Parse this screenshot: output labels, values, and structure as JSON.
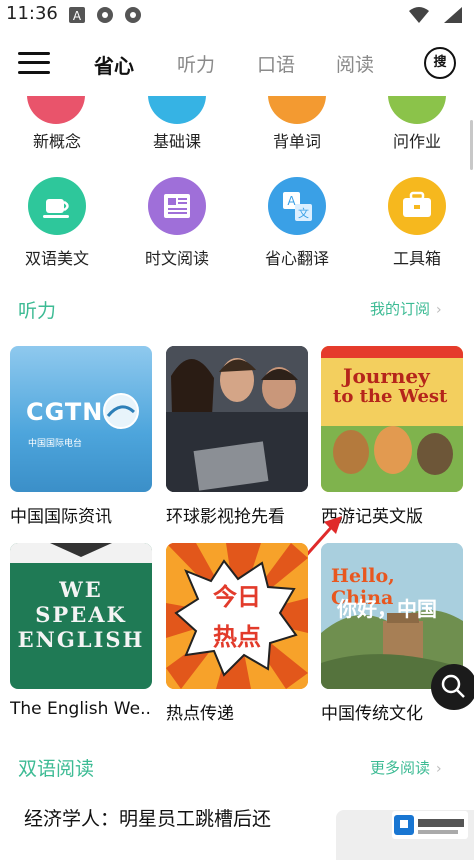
{
  "status": {
    "time": "11:36"
  },
  "header": {
    "tabs": [
      {
        "label": "省心",
        "active": true
      },
      {
        "label": "听力",
        "active": false
      },
      {
        "label": "口语",
        "active": false
      },
      {
        "label": "阅读",
        "active": false
      }
    ],
    "search_label": "搜"
  },
  "grid": [
    {
      "label": "新概念",
      "color": "#e9546b"
    },
    {
      "label": "基础课",
      "color": "#36b3e4"
    },
    {
      "label": "背单词",
      "color": "#f39a31"
    },
    {
      "label": "问作业",
      "color": "#8bc34a"
    },
    {
      "label": "双语美文",
      "color": "#2ec79b"
    },
    {
      "label": "时文阅读",
      "color": "#9f6fd9"
    },
    {
      "label": "省心翻译",
      "color": "#3aa0e6"
    },
    {
      "label": "工具箱",
      "color": "#f6b81e"
    }
  ],
  "listening": {
    "title": "听力",
    "link": "我的订阅",
    "cards": [
      {
        "title": "中国国际资讯",
        "logo": "CGTN",
        "logo_sub": "中国国际电台"
      },
      {
        "title": "环球影视抢先看"
      },
      {
        "title": "西游记英文版",
        "cover_line1": "Journey",
        "cover_line2": "to the West"
      },
      {
        "title": "The English We...",
        "cover_lines": [
          "WE",
          "SPEAK",
          "ENGLISH"
        ]
      },
      {
        "title": "热点传递",
        "cover_lines": [
          "今日",
          "热点"
        ]
      },
      {
        "title": "中国传统文化",
        "cover_line1": "Hello, China",
        "cover_line2": "你好，中国"
      }
    ]
  },
  "reading": {
    "title": "双语阅读",
    "link": "更多阅读",
    "article_title": "经济学人：明星员工跳槽后还"
  },
  "accent": "#3dbb94"
}
